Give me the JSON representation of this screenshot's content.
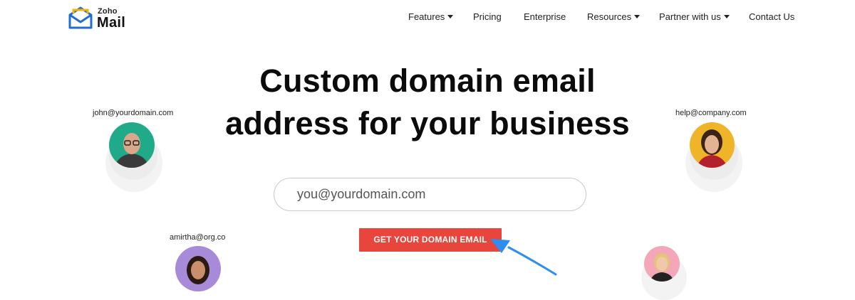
{
  "brand": {
    "company": "Zoho",
    "product": "Mail",
    "logo_icon": "envelope-icon"
  },
  "nav": {
    "items": [
      {
        "label": "Features",
        "dropdown": true
      },
      {
        "label": "Pricing",
        "dropdown": false
      },
      {
        "label": "Enterprise",
        "dropdown": false
      },
      {
        "label": "Resources",
        "dropdown": true
      },
      {
        "label": "Partner with us",
        "dropdown": true
      },
      {
        "label": "Contact Us",
        "dropdown": false
      }
    ]
  },
  "hero": {
    "title_line1": "Custom domain email",
    "title_line2": "address for your business",
    "email_placeholder": "you@yourdomain.com",
    "cta_label": "GET YOUR DOMAIN EMAIL"
  },
  "personas": [
    {
      "email": "john@yourdomain.com",
      "bg": "#1fab89"
    },
    {
      "email": "help@company.com",
      "bg": "#f0b429"
    },
    {
      "email": "amirtha@org.co",
      "bg": "#a78bd8"
    },
    {
      "email": "",
      "bg": "#f4a7b9"
    }
  ],
  "colors": {
    "cta": "#e8453c",
    "arrow": "#2f8ef0",
    "logo_blue": "#1f6fd1",
    "logo_yellow": "#f5b400"
  }
}
